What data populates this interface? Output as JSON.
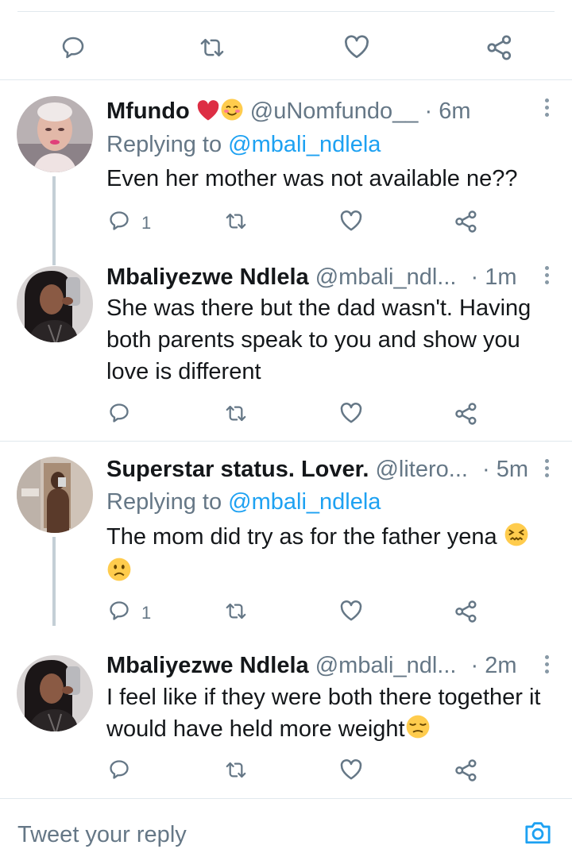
{
  "top_actions": {
    "reply_icon": "reply-icon",
    "retweet_icon": "retweet-icon",
    "like_icon": "heart-icon",
    "share_icon": "share-icon"
  },
  "tweets": [
    {
      "name": "Mfundo",
      "handle": "@uNomfundo__",
      "separator": "·",
      "time": "6m",
      "replying_prefix": "Replying to",
      "replying_to": "@mbali_ndlela",
      "text": "Even her mother was not available ne??",
      "reply_count": "1"
    },
    {
      "name": "Mbaliyezwe Ndlela",
      "handle": "@mbali_ndl...",
      "separator": "·",
      "time": "1m",
      "text": "She was there but the dad wasn't. Having both parents speak to you and show you love is different",
      "reply_count": ""
    },
    {
      "name": "Superstar status. Lover.",
      "handle": "@litero...",
      "separator": "·",
      "time": "5m",
      "replying_prefix": "Replying to",
      "replying_to": "@mbali_ndlela",
      "text": "The mom did try as for the father yena",
      "reply_count": "1"
    },
    {
      "name": "Mbaliyezwe Ndlela",
      "handle": "@mbali_ndl...",
      "separator": "·",
      "time": "2m",
      "text": "I feel like if they were both there together it would have held more weight",
      "reply_count": ""
    }
  ],
  "composer": {
    "placeholder": "Tweet your reply",
    "camera_icon": "camera-icon"
  },
  "colors": {
    "accent": "#1da1f2",
    "muted": "#657786",
    "text": "#14171a",
    "divider": "#e1e8ed",
    "heart_emoji": "#e0245e"
  }
}
